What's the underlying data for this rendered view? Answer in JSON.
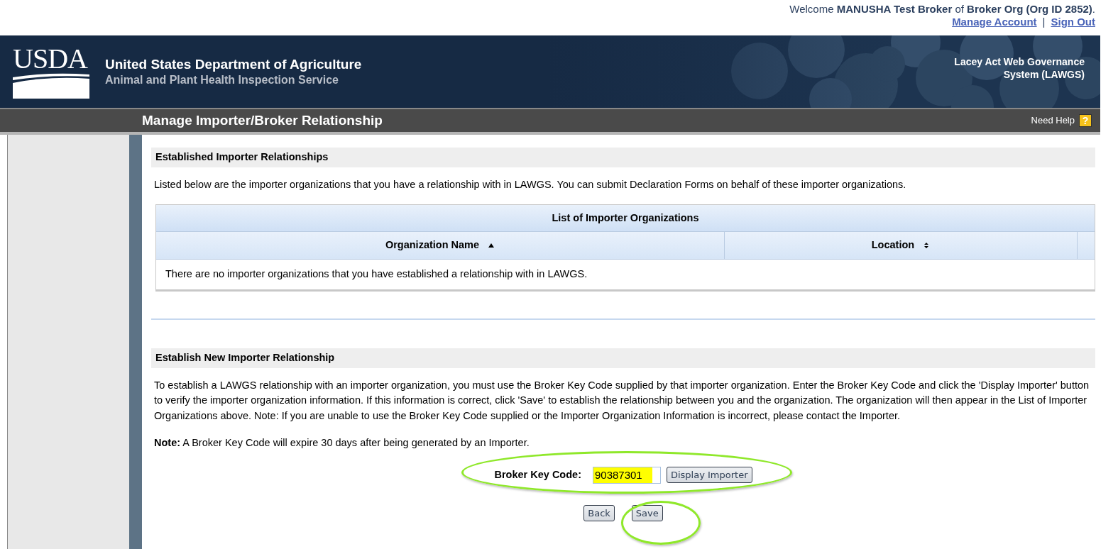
{
  "user_bar": {
    "welcome": "Welcome **MANUSHA Test Broker** of **Broker Org (Org ID 2852)**.",
    "links": [
      "Manage Account",
      "Sign Out"
    ],
    "separator": "|"
  },
  "header": {
    "logo_text": "USDA",
    "department": "United States Department of Agriculture",
    "service": "Animal and Plant Health Inspection Service",
    "system_name": [
      "Lacey Act Web Governance",
      "System (LAWGS)"
    ]
  },
  "title_bar": {
    "title": "Manage Importer/Broker Relationship",
    "help_label": "Need Help",
    "help_icon": "?"
  },
  "established": {
    "heading": "Established Importer Relationships",
    "intro": "Listed below are the importer organizations that you have a relationship with in LAWGS. You can submit Declaration Forms on behalf of these importer organizations.",
    "table": {
      "caption": "List of Importer Organizations",
      "columns": [
        {
          "label": "Organization Name",
          "sorted": true
        },
        {
          "label": "Location",
          "sorted": false
        }
      ],
      "empty_message": "There are no importer organizations that you have established a relationship with in LAWGS."
    }
  },
  "establish_new": {
    "heading": "Establish New Importer Relationship",
    "instructions": "To establish a LAWGS relationship with an importer organization, you must use the Broker Key Code supplied by that importer organization. Enter the Broker Key Code and click the 'Display Importer' button to verify the importer organization information. If this information is correct, click 'Save' to establish the relationship between you and the organization. The organization will then appear in the List of Importer Organizations above. Note: If you are unable to use the Broker Key Code supplied or the Importer Organization Information is incorrect, please contact the Importer.",
    "note": "**Note:** A Broker Key Code will expire 30 days after being generated by an Importer.",
    "key_label": "Broker Key Code:",
    "key_value": "90387301",
    "key_selected": true,
    "display_button": "Display Importer",
    "buttons": [
      "Back",
      "Save"
    ]
  }
}
